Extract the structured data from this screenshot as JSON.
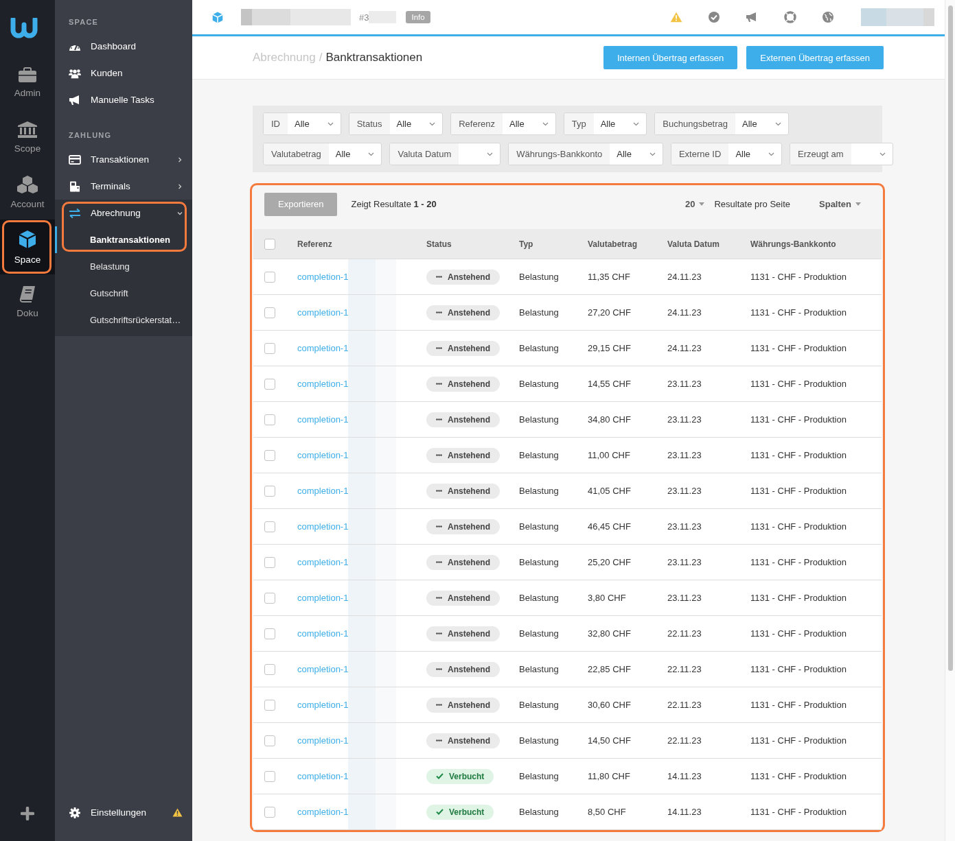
{
  "rail": {
    "items": [
      {
        "label": "Admin",
        "kind": "briefcase",
        "selected": false,
        "highlighted": false
      },
      {
        "label": "Scope",
        "kind": "bank",
        "selected": false,
        "highlighted": false
      },
      {
        "label": "Account",
        "kind": "cubes",
        "selected": false,
        "highlighted": false
      },
      {
        "label": "Space",
        "kind": "cube",
        "selected": true,
        "highlighted": true
      },
      {
        "label": "Doku",
        "kind": "book",
        "selected": false,
        "highlighted": false
      }
    ]
  },
  "sidebar": {
    "sections": [
      {
        "title": "SPACE",
        "items": [
          {
            "label": "Dashboard",
            "kind": "gauge",
            "has_submenu": false
          },
          {
            "label": "Kunden",
            "kind": "users",
            "has_submenu": false
          },
          {
            "label": "Manuelle Tasks",
            "kind": "megaphone",
            "has_submenu": false
          }
        ]
      },
      {
        "title": "ZAHLUNG",
        "items": [
          {
            "label": "Transaktionen",
            "kind": "card",
            "has_submenu": true
          },
          {
            "label": "Terminals",
            "kind": "terminal",
            "has_submenu": true
          },
          {
            "label": "Abrechnung",
            "kind": "arrows",
            "has_submenu": true,
            "expanded": true,
            "highlighted": true,
            "children": [
              {
                "label": "Banktransaktionen",
                "selected": true
              },
              {
                "label": "Belastung",
                "selected": false
              },
              {
                "label": "Gutschrift",
                "selected": false
              },
              {
                "label": "Gutschriftsrückerstat…",
                "selected": false
              }
            ]
          }
        ]
      }
    ],
    "footer": {
      "label": "Einstellungen",
      "warning": true
    }
  },
  "topbar": {
    "ref": "#3",
    "badge": "Info"
  },
  "breadcrumb": {
    "parent": "Abrechnung",
    "separator": "/",
    "current": "Banktransaktionen"
  },
  "actions": [
    "Internen Übertrag erfassen",
    "Externen Übertrag erfassen"
  ],
  "filters": [
    [
      {
        "label": "ID",
        "value": "Alle"
      },
      {
        "label": "Status",
        "value": "Alle"
      },
      {
        "label": "Referenz",
        "value": "Alle"
      },
      {
        "label": "Typ",
        "value": "Alle"
      },
      {
        "label": "Buchungsbetrag",
        "value": "Alle"
      }
    ],
    [
      {
        "label": "Valutabetrag",
        "value": "Alle"
      },
      {
        "label": "Valuta Datum"
      },
      {
        "label": "Währungs-Bankkonto",
        "value": "Alle"
      },
      {
        "label": "Externe ID",
        "value": "Alle"
      },
      {
        "label": "Erzeugt am"
      }
    ]
  ],
  "table": {
    "highlighted": true,
    "export_button": "Exportieren",
    "results": "Zeigt Resultate **1 - 20**",
    "page_size": "20",
    "page_size_label": "Resultate pro Seite",
    "columns_button": "Spalten",
    "select_all": {
      "checked": false
    },
    "columns": [
      "Referenz",
      "Status",
      "Typ",
      "Valutabetrag",
      "Valuta Datum",
      "Währungs-Bankkonto"
    ],
    "rows": [
      {
        "checked": false,
        "reference": "completion-1",
        "status": "Anstehend",
        "kind": "pending",
        "type": "Belastung",
        "amount": "11,35 CHF",
        "date": "24.11.23",
        "account": "1131 - CHF - Produktion"
      },
      {
        "checked": false,
        "reference": "completion-1",
        "status": "Anstehend",
        "kind": "pending",
        "type": "Belastung",
        "amount": "27,20 CHF",
        "date": "24.11.23",
        "account": "1131 - CHF - Produktion"
      },
      {
        "checked": false,
        "reference": "completion-1",
        "status": "Anstehend",
        "kind": "pending",
        "type": "Belastung",
        "amount": "29,15 CHF",
        "date": "24.11.23",
        "account": "1131 - CHF - Produktion"
      },
      {
        "checked": false,
        "reference": "completion-1",
        "status": "Anstehend",
        "kind": "pending",
        "type": "Belastung",
        "amount": "14,55 CHF",
        "date": "23.11.23",
        "account": "1131 - CHF - Produktion"
      },
      {
        "checked": false,
        "reference": "completion-1",
        "status": "Anstehend",
        "kind": "pending",
        "type": "Belastung",
        "amount": "34,80 CHF",
        "date": "23.11.23",
        "account": "1131 - CHF - Produktion"
      },
      {
        "checked": false,
        "reference": "completion-1",
        "status": "Anstehend",
        "kind": "pending",
        "type": "Belastung",
        "amount": "11,00 CHF",
        "date": "23.11.23",
        "account": "1131 - CHF - Produktion"
      },
      {
        "checked": false,
        "reference": "completion-1",
        "status": "Anstehend",
        "kind": "pending",
        "type": "Belastung",
        "amount": "41,05 CHF",
        "date": "23.11.23",
        "account": "1131 - CHF - Produktion"
      },
      {
        "checked": false,
        "reference": "completion-1",
        "status": "Anstehend",
        "kind": "pending",
        "type": "Belastung",
        "amount": "46,45 CHF",
        "date": "23.11.23",
        "account": "1131 - CHF - Produktion"
      },
      {
        "checked": false,
        "reference": "completion-1",
        "status": "Anstehend",
        "kind": "pending",
        "type": "Belastung",
        "amount": "25,20 CHF",
        "date": "23.11.23",
        "account": "1131 - CHF - Produktion"
      },
      {
        "checked": false,
        "reference": "completion-1",
        "status": "Anstehend",
        "kind": "pending",
        "type": "Belastung",
        "amount": "3,80 CHF",
        "date": "23.11.23",
        "account": "1131 - CHF - Produktion"
      },
      {
        "checked": false,
        "reference": "completion-1",
        "status": "Anstehend",
        "kind": "pending",
        "type": "Belastung",
        "amount": "32,80 CHF",
        "date": "22.11.23",
        "account": "1131 - CHF - Produktion"
      },
      {
        "checked": false,
        "reference": "completion-1",
        "status": "Anstehend",
        "kind": "pending",
        "type": "Belastung",
        "amount": "22,85 CHF",
        "date": "22.11.23",
        "account": "1131 - CHF - Produktion"
      },
      {
        "checked": false,
        "reference": "completion-1",
        "status": "Anstehend",
        "kind": "pending",
        "type": "Belastung",
        "amount": "30,60 CHF",
        "date": "22.11.23",
        "account": "1131 - CHF - Produktion"
      },
      {
        "checked": false,
        "reference": "completion-1",
        "status": "Anstehend",
        "kind": "pending",
        "type": "Belastung",
        "amount": "14,50 CHF",
        "date": "22.11.23",
        "account": "1131 - CHF - Produktion"
      },
      {
        "checked": false,
        "reference": "completion-1",
        "status": "Verbucht",
        "kind": "booked",
        "type": "Belastung",
        "amount": "11,80 CHF",
        "date": "14.11.23",
        "account": "1131 - CHF - Produktion"
      },
      {
        "checked": false,
        "reference": "completion-1",
        "status": "Verbucht",
        "kind": "booked",
        "type": "Belastung",
        "amount": "8,50 CHF",
        "date": "14.11.23",
        "account": "1131 - CHF - Produktion"
      }
    ]
  }
}
